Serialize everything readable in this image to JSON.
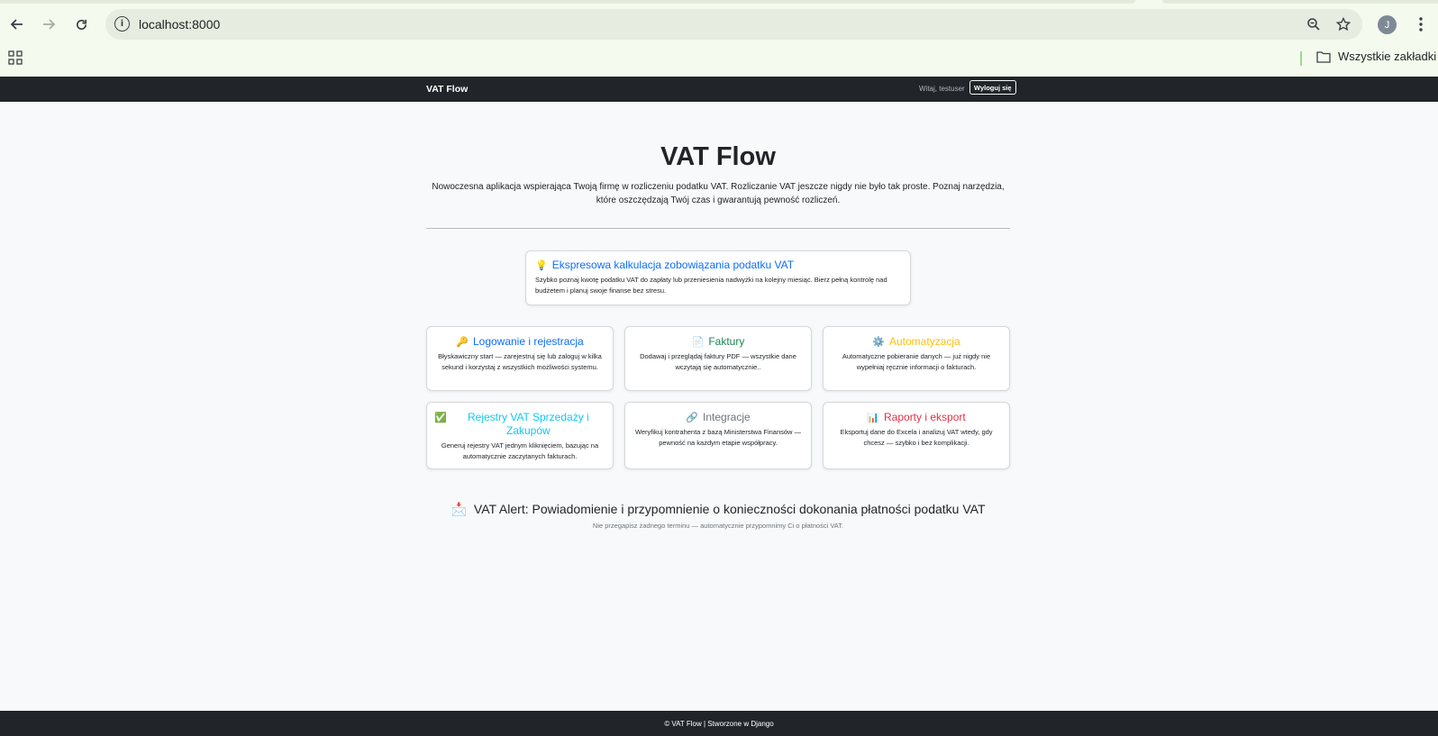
{
  "browser": {
    "url": "localhost:8000",
    "avatar_letter": "J",
    "bookmarks_folder": "Wszystkie zakładki"
  },
  "navbar": {
    "brand": "VAT Flow",
    "welcome": "Witaj, testuser",
    "logout_label": "Wyloguj się"
  },
  "hero": {
    "title": "VAT Flow",
    "lead_line1": "Nowoczesna aplikacja wspierająca Twoją firmę w rozliczeniu podatku VAT. Rozliczanie VAT jeszcze nigdy nie było tak proste. Poznaj narzędzia,",
    "lead_line2": "które oszczędzają Twój czas i gwarantują pewność rozliczeń."
  },
  "featured": {
    "icon": "💡",
    "title": "Ekspresowa kalkulacja zobowiązania podatku VAT",
    "text": "Szybko poznaj kwotę podatku VAT do zapłaty lub przeniesienia nadwyżki na kolejny miesiąc. Bierz pełną kontrolę nad budżetem i planuj swoje finanse bez stresu.",
    "color": "#0d6efd"
  },
  "features": [
    {
      "icon": "🔑",
      "title": "Logowanie i rejestracja",
      "text": "Błyskawiczny start — zarejestruj się lub zaloguj w kilka sekund i korzystaj z wszystkich możliwości systemu.",
      "color": "#0d6efd"
    },
    {
      "icon": "📄",
      "title": "Faktury",
      "text": "Dodawaj i przeglądaj faktury PDF — wszystkie dane wczytają się automatycznie..",
      "color": "#198754"
    },
    {
      "icon": "⚙️",
      "title": "Automatyzacja",
      "text": "Automatyczne pobieranie danych — już nigdy nie wypełniaj ręcznie informacji o fakturach.",
      "color": "#ffc107"
    },
    {
      "icon": "✅",
      "title": "Rejestry VAT Sprzedaży i Zakupów",
      "text": "Generuj rejestry VAT jednym kliknięciem, bazując na automatycznie zaczytanych fakturach.",
      "color": "#0dcaf0"
    },
    {
      "icon": "🔗",
      "title": "Integracje",
      "text": "Weryfikuj kontrahenta z bazą Ministerstwa Finansów — pewność na każdym etapie współpracy.",
      "color": "#6c757d"
    },
    {
      "icon": "📊",
      "title": "Raporty i eksport",
      "text": "Eksportuj dane do Excela i analizuj VAT wtedy, gdy chcesz — szybko i bez komplikacji.",
      "color": "#dc3545"
    }
  ],
  "alert": {
    "icon": "📩",
    "title": "VAT Alert: Powiadomienie i przypomnienie o konieczności dokonania płatności podatku VAT",
    "subtitle": "Nie przegapisz żadnego terminu — automatycznie przypomnimy Ci o płatności VAT."
  },
  "footer": {
    "text": "© VAT Flow | Stworzone w Django"
  }
}
